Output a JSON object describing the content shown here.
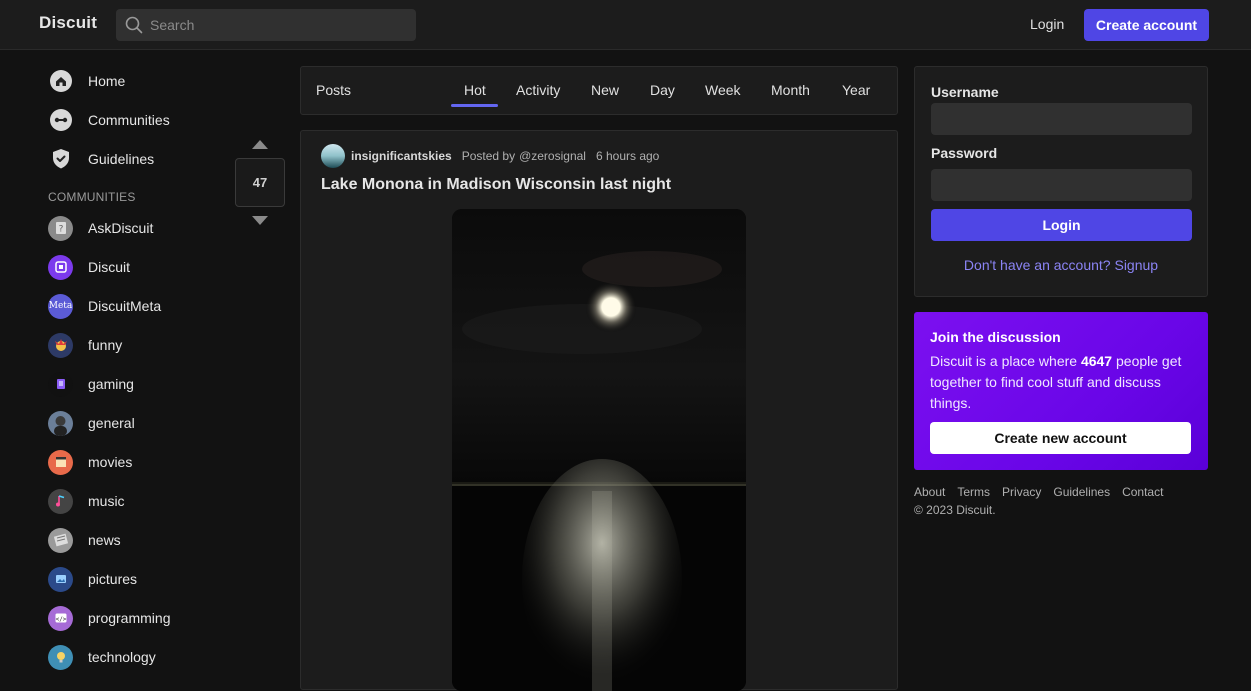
{
  "header": {
    "logo": "Discuit",
    "search_placeholder": "Search",
    "login_label": "Login",
    "create_account_label": "Create account"
  },
  "sidebar": {
    "nav": [
      {
        "label": "Home",
        "icon": "home-icon"
      },
      {
        "label": "Communities",
        "icon": "communities-icon"
      },
      {
        "label": "Guidelines",
        "icon": "shield-check-icon"
      }
    ],
    "section_title": "COMMUNITIES",
    "communities": [
      {
        "label": "AskDiscuit",
        "color": "#8a8a8a"
      },
      {
        "label": "Discuit",
        "color": "#7c3aed"
      },
      {
        "label": "DiscuitMeta",
        "color": "#5b5bd6",
        "avatar_text": "Meta"
      },
      {
        "label": "funny",
        "color": "#2d3a66"
      },
      {
        "label": "gaming",
        "color": "#111111"
      },
      {
        "label": "general",
        "color": "#6b7f99"
      },
      {
        "label": "movies",
        "color": "#e86a4a"
      },
      {
        "label": "music",
        "color": "#444444"
      },
      {
        "label": "news",
        "color": "#9a9a9a"
      },
      {
        "label": "pictures",
        "color": "#2b4a8a"
      },
      {
        "label": "programming",
        "color": "#a66bd6"
      },
      {
        "label": "technology",
        "color": "#3f8fb5"
      }
    ]
  },
  "feed": {
    "posts_label": "Posts",
    "tabs": [
      "Hot",
      "Activity",
      "New",
      "Day",
      "Week",
      "Month",
      "Year"
    ],
    "active_tab": "Hot"
  },
  "post": {
    "votes": "47",
    "community": "insignificantskies",
    "posted_by": "Posted by",
    "author": "@zerosignal",
    "time": "6 hours ago",
    "title": "Lake Monona in Madison Wisconsin last night"
  },
  "login_card": {
    "username_label": "Username",
    "password_label": "Password",
    "login_button": "Login",
    "signup_link": "Don't have an account? Signup"
  },
  "join_card": {
    "title": "Join the discussion",
    "desc_before": "Discuit is a place where ",
    "user_count": "4647",
    "desc_after": " people get together to find cool stuff and discuss things.",
    "button": "Create new account"
  },
  "footer": {
    "links": [
      "About",
      "Terms",
      "Privacy",
      "Guidelines",
      "Contact"
    ],
    "copyright": "© 2023 Discuit."
  },
  "colors": {
    "accent": "#4f46e5",
    "join_card": "#7c10f0",
    "background": "#121212"
  }
}
